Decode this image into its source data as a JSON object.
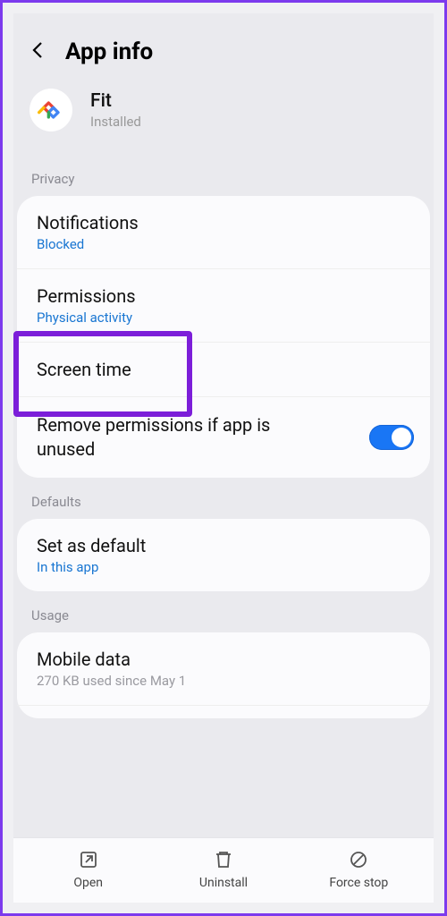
{
  "header": {
    "title": "App info"
  },
  "app": {
    "name": "Fit",
    "status": "Installed"
  },
  "sections": {
    "privacy_label": "Privacy",
    "defaults_label": "Defaults",
    "usage_label": "Usage"
  },
  "privacy": {
    "notifications": {
      "title": "Notifications",
      "sub": "Blocked"
    },
    "permissions": {
      "title": "Permissions",
      "sub": "Physical activity"
    },
    "screen_time": {
      "title": "Screen time"
    },
    "remove_perm": {
      "title": "Remove permissions if app is unused",
      "enabled": true
    }
  },
  "defaults": {
    "set_default": {
      "title": "Set as default",
      "sub": "In this app"
    }
  },
  "usage": {
    "mobile_data": {
      "title": "Mobile data",
      "sub": "270 KB used since May 1"
    }
  },
  "bottom": {
    "open": "Open",
    "uninstall": "Uninstall",
    "force_stop": "Force stop"
  }
}
